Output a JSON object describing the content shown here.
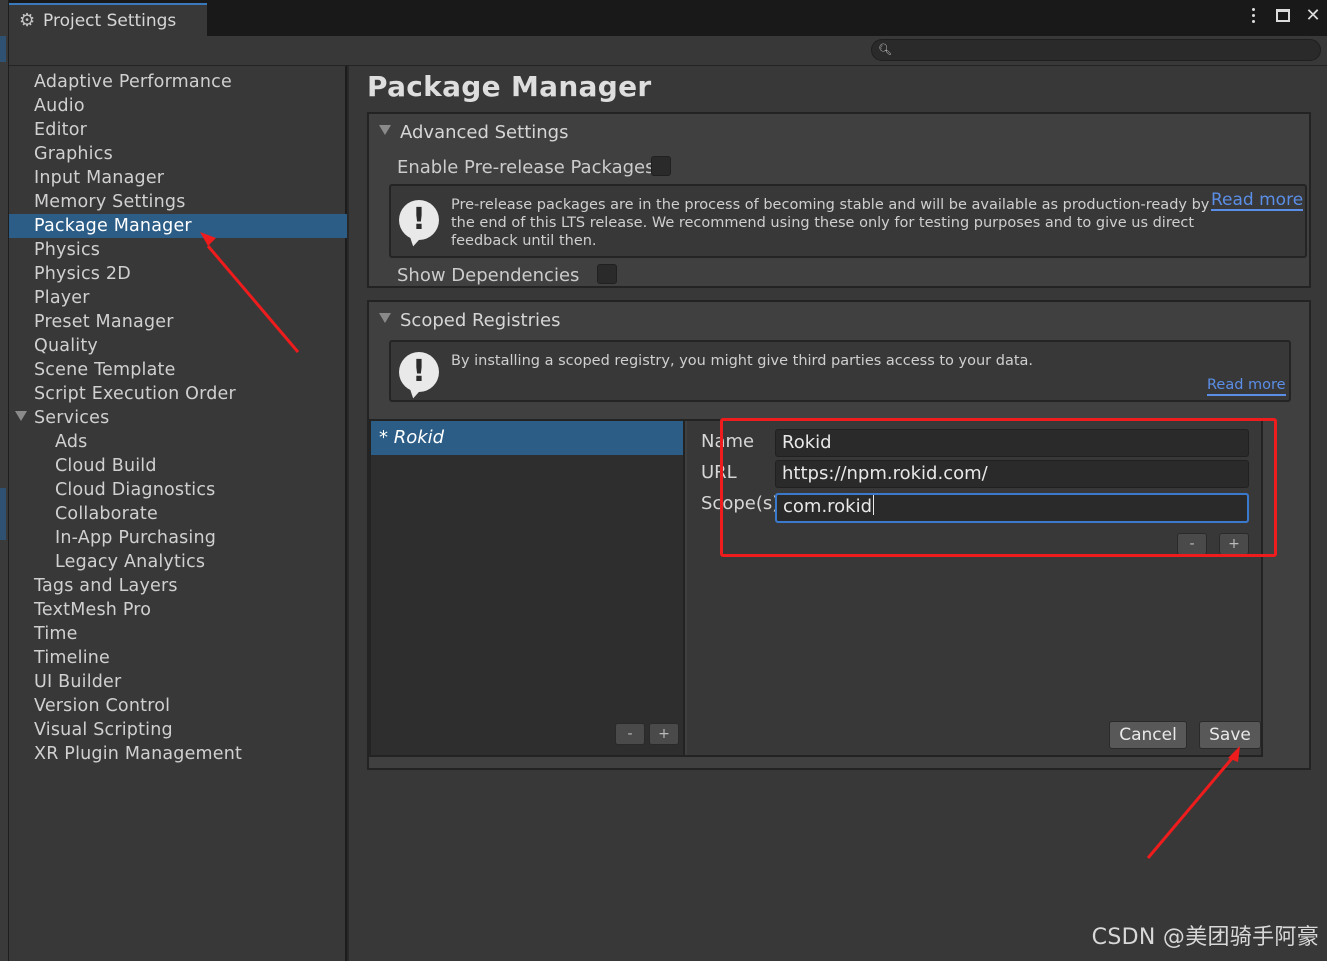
{
  "window": {
    "tab_title": "Project Settings",
    "search": {
      "placeholder": ""
    }
  },
  "sidebar": {
    "items": [
      {
        "label": "Adaptive Performance"
      },
      {
        "label": "Audio"
      },
      {
        "label": "Editor"
      },
      {
        "label": "Graphics"
      },
      {
        "label": "Input Manager"
      },
      {
        "label": "Memory Settings"
      },
      {
        "label": "Package Manager",
        "selected": true
      },
      {
        "label": "Physics"
      },
      {
        "label": "Physics 2D"
      },
      {
        "label": "Player"
      },
      {
        "label": "Preset Manager"
      },
      {
        "label": "Quality"
      },
      {
        "label": "Scene Template"
      },
      {
        "label": "Script Execution Order"
      },
      {
        "label": "Services",
        "expanded": true
      },
      {
        "label": "Ads",
        "indent": 1
      },
      {
        "label": "Cloud Build",
        "indent": 1
      },
      {
        "label": "Cloud Diagnostics",
        "indent": 1
      },
      {
        "label": "Collaborate",
        "indent": 1
      },
      {
        "label": "In-App Purchasing",
        "indent": 1
      },
      {
        "label": "Legacy Analytics",
        "indent": 1
      },
      {
        "label": "Tags and Layers"
      },
      {
        "label": "TextMesh Pro"
      },
      {
        "label": "Time"
      },
      {
        "label": "Timeline"
      },
      {
        "label": "UI Builder"
      },
      {
        "label": "Version Control"
      },
      {
        "label": "Visual Scripting"
      },
      {
        "label": "XR Plugin Management"
      }
    ]
  },
  "main": {
    "title": "Package Manager",
    "advanced": {
      "header": "Advanced Settings",
      "prerelease_label": "Enable Pre-release Packages",
      "prerelease_checked": false,
      "help_lines": [
        "Pre-release packages are in the process of becoming stable and will be available as production-ready by",
        "the end of this LTS release. We recommend using these only for testing purposes and to give us direct",
        "feedback until then."
      ],
      "read_more": "Read more",
      "dependencies_label": "Show Dependencies",
      "dependencies_checked": false
    },
    "scoped": {
      "header": "Scoped Registries",
      "help_text": "By installing a scoped registry, you might give third parties access to your data.",
      "read_more": "Read more",
      "registries": [
        {
          "label": "* Rokid"
        }
      ],
      "list_remove": "-",
      "list_add": "+",
      "name_label": "Name",
      "name_value": "Rokid",
      "url_label": "URL",
      "url_value": "https://npm.rokid.com/",
      "scope_label": "Scope(s)",
      "scope_value": "com.rokid",
      "scope_remove": "-",
      "scope_add": "+",
      "cancel_label": "Cancel",
      "save_label": "Save"
    }
  },
  "watermark": "CSDN @美团骑手阿豪",
  "colors": {
    "selection": "#2c5d87",
    "annotation": "#ee1c1c",
    "link": "#5b8ee6"
  }
}
